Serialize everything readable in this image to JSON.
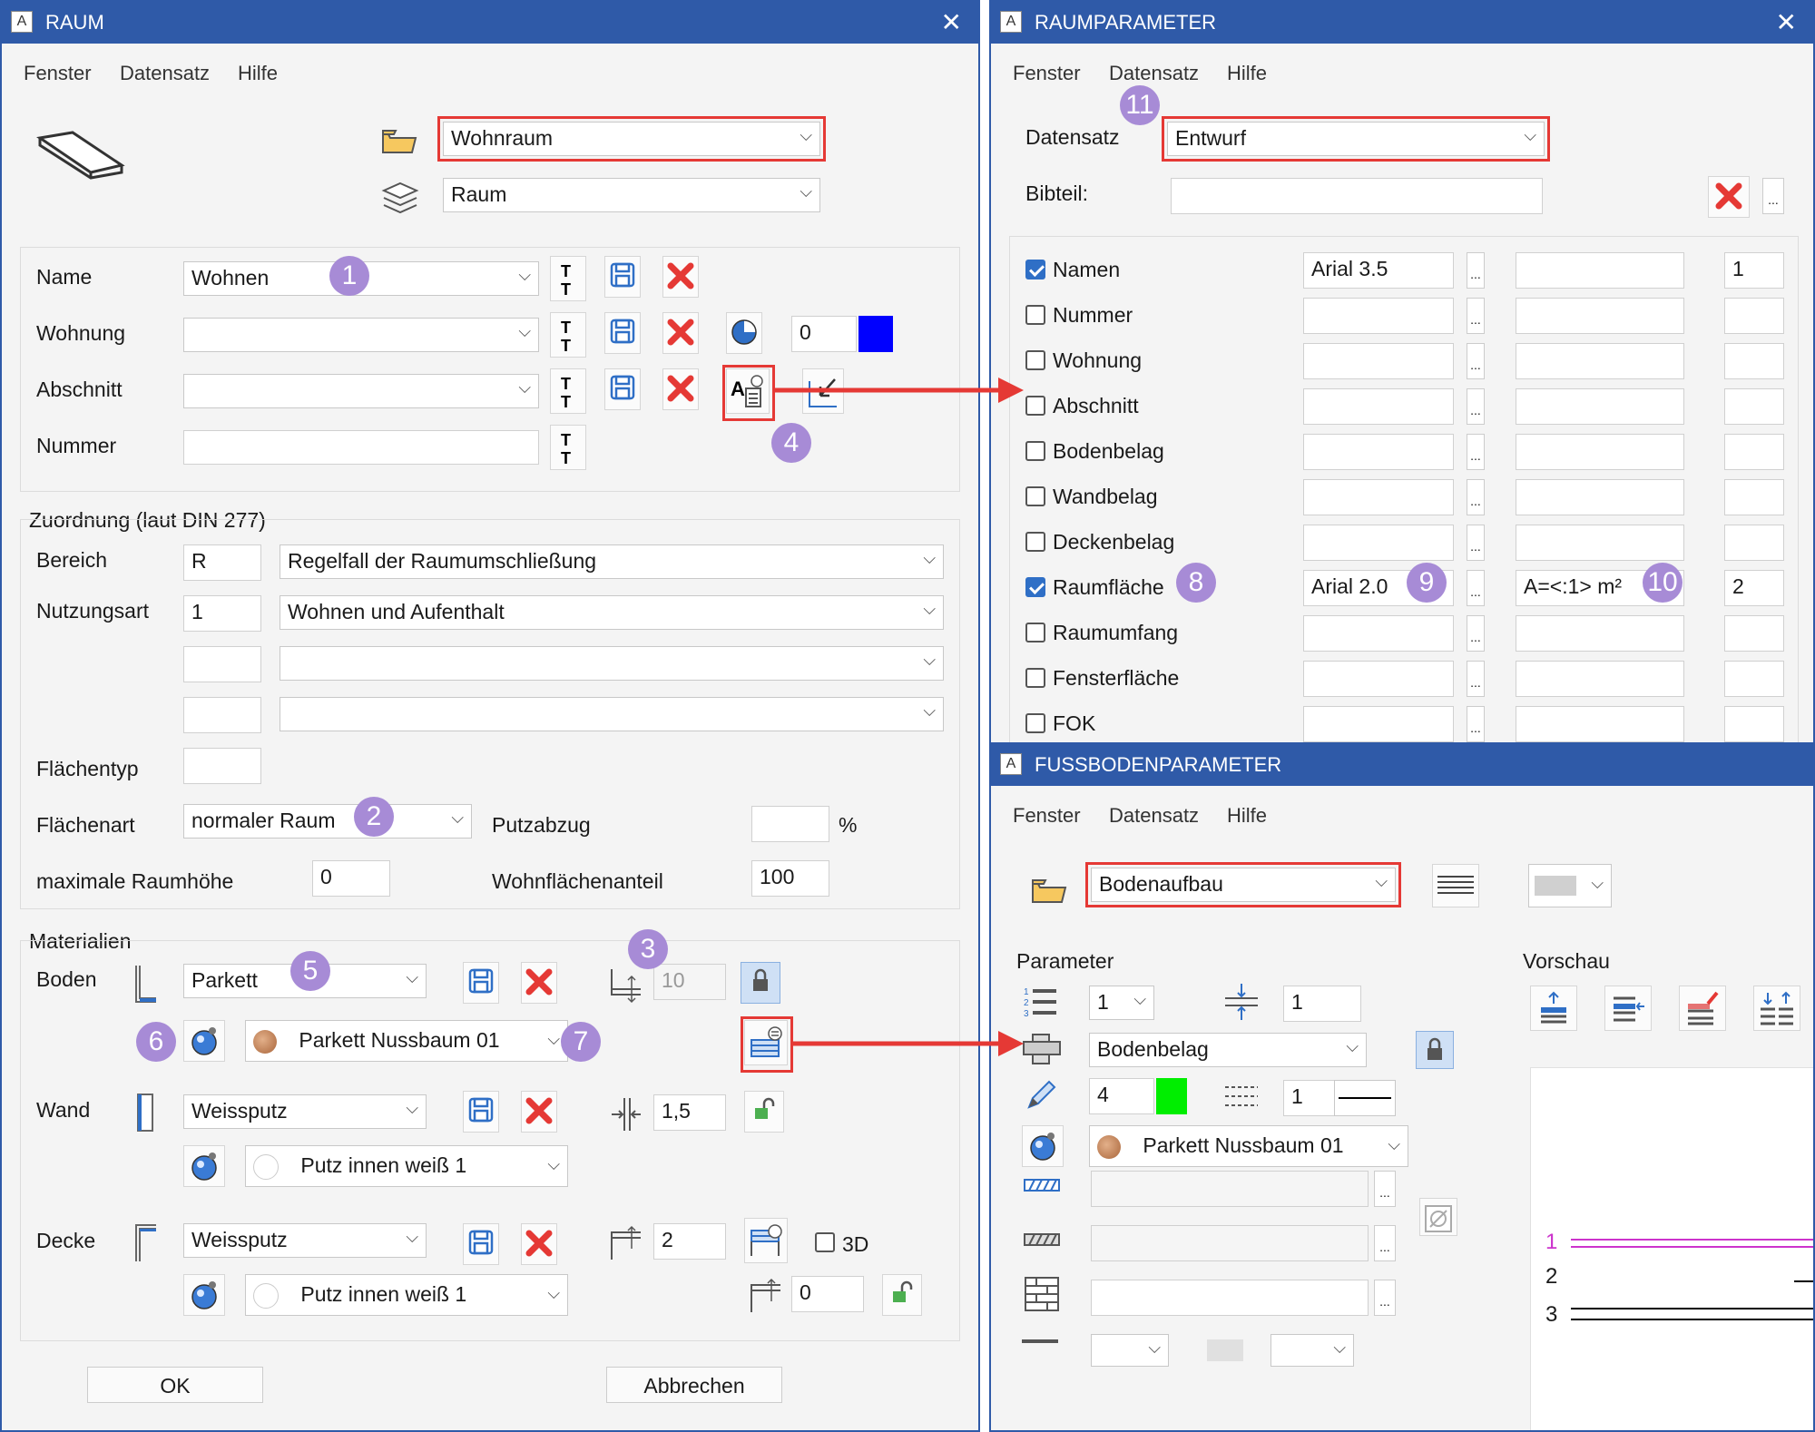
{
  "colors": {
    "title_bar": "#2f5aa8",
    "badge": "#a78bd6",
    "highlight_red": "#e53935",
    "wohnung_color": "#0000ff",
    "line_color_green": "#00ee00",
    "preview_line1": "#cc33cc"
  },
  "raum": {
    "title": "RAUM",
    "close": "✕",
    "menu": [
      "Fenster",
      "Datensatz",
      "Hilfe"
    ],
    "favorite": "Wohnraum",
    "layer": "Raum",
    "name_label": "Name",
    "name_value": "Wohnen",
    "wohnung_label": "Wohnung",
    "wohnung_value": "",
    "wohnung_color_index": "0",
    "abschnitt_label": "Abschnitt",
    "abschnitt_value": "",
    "nummer_label": "Nummer",
    "nummer_value": "",
    "zuordnung_title": "Zuordnung (laut DIN 277)",
    "bereich_label": "Bereich",
    "bereich_code": "R",
    "bereich_text": "Regelfall der Raumumschließung",
    "nutzungsart_label": "Nutzungsart",
    "nutzungsart_code": "1",
    "nutzungsart_text": "Wohnen und Aufenthalt",
    "flaechentyp_label": "Flächentyp",
    "flaechenart_label": "Flächenart",
    "flaechenart_value": "normaler Raum",
    "putzabzug_label": "Putzabzug",
    "putzabzug_unit": "%",
    "max_raumhoehe_label": "maximale Raumhöhe",
    "max_raumhoehe_value": "0",
    "wohnflaechenanteil_label": "Wohnflächenanteil",
    "wohnflaechenanteil_value": "100",
    "materialien_title": "Materialien",
    "boden_label": "Boden",
    "boden_value": "Parkett",
    "boden_material": "Parkett Nussbaum 01",
    "boden_thickness": "10",
    "wand_label": "Wand",
    "wand_value": "Weissputz",
    "wand_material": "Putz innen weiß 1",
    "wand_thickness": "1,5",
    "decke_label": "Decke",
    "decke_value": "Weissputz",
    "decke_material": "Putz innen weiß 1",
    "decke_thickness": "2",
    "decke_3d_label": "3D",
    "decke_offset": "0",
    "ok": "OK",
    "cancel": "Abbrechen"
  },
  "raumparameter": {
    "title": "RAUMPARAMETER",
    "close": "✕",
    "menu": [
      "Fenster",
      "Datensatz",
      "Hilfe"
    ],
    "datensatz_label": "Datensatz",
    "datensatz_value": "Entwurf",
    "bibteil_label": "Bibteil:",
    "bibteil_value": "",
    "rows": [
      {
        "label": "Namen",
        "checked": true,
        "font": "Arial 3.5",
        "text": "",
        "num": "1"
      },
      {
        "label": "Nummer",
        "checked": false,
        "font": "",
        "text": "",
        "num": ""
      },
      {
        "label": "Wohnung",
        "checked": false,
        "font": "",
        "text": "",
        "num": ""
      },
      {
        "label": "Abschnitt",
        "checked": false,
        "font": "",
        "text": "",
        "num": ""
      },
      {
        "label": "Bodenbelag",
        "checked": false,
        "font": "",
        "text": "",
        "num": ""
      },
      {
        "label": "Wandbelag",
        "checked": false,
        "font": "",
        "text": "",
        "num": ""
      },
      {
        "label": "Deckenbelag",
        "checked": false,
        "font": "",
        "text": "",
        "num": ""
      },
      {
        "label": "Raumfläche",
        "checked": true,
        "font": "Arial 2.0",
        "text": "A=<:1> m²",
        "num": "2"
      },
      {
        "label": "Raumumfang",
        "checked": false,
        "font": "",
        "text": "",
        "num": ""
      },
      {
        "label": "Fensterfläche",
        "checked": false,
        "font": "",
        "text": "",
        "num": ""
      },
      {
        "label": "FOK",
        "checked": false,
        "font": "",
        "text": "",
        "num": ""
      }
    ],
    "dots": "..."
  },
  "fussbodenparameter": {
    "title": "FUSSBODENPARAMETER",
    "menu": [
      "Fenster",
      "Datensatz",
      "Hilfe"
    ],
    "favorite": "Bodenaufbau",
    "parameter_label": "Parameter",
    "vorschau_label": "Vorschau",
    "layer_count": "1",
    "spacing": "1",
    "layer_type": "Bodenbelag",
    "pen_value": "4",
    "linetype_value": "1",
    "material": "Parkett Nussbaum 01",
    "dots": "...",
    "preview_labels": [
      "1",
      "2",
      "3"
    ]
  },
  "badges": [
    "1",
    "2",
    "3",
    "4",
    "5",
    "6",
    "7",
    "8",
    "9",
    "10",
    "11"
  ]
}
